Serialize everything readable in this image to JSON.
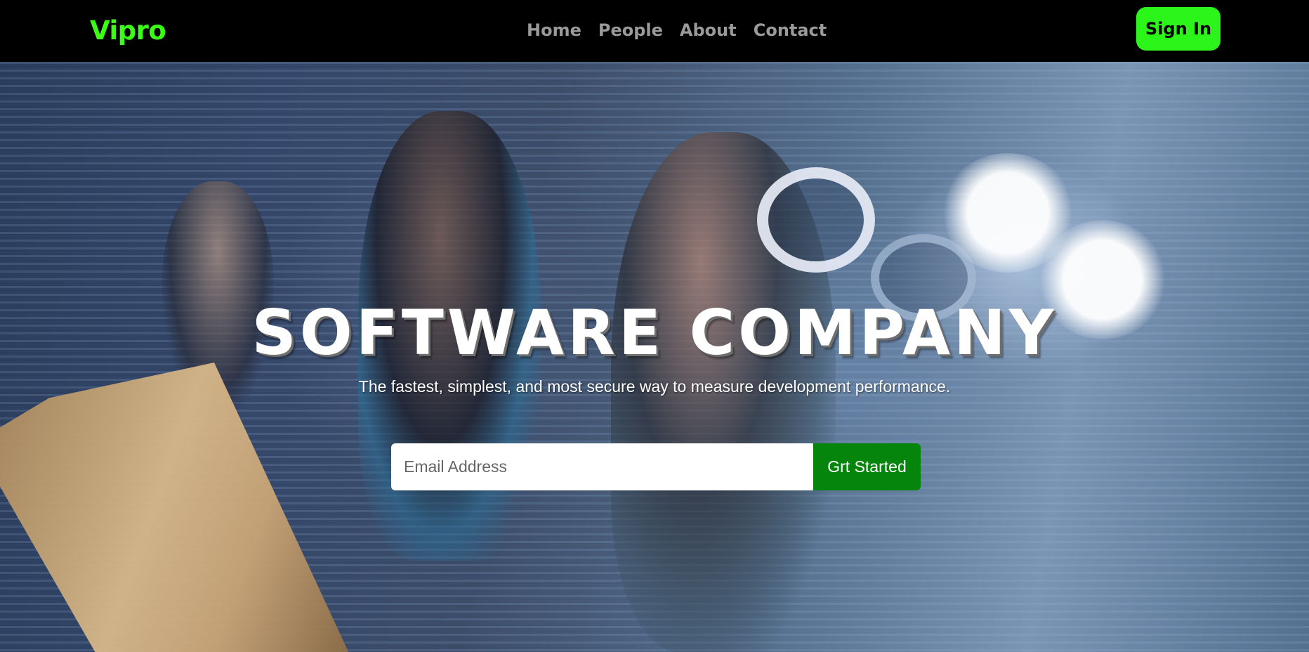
{
  "brand": {
    "name": "Vipro",
    "color": "#39ff14"
  },
  "nav": {
    "links": [
      {
        "label": "Home"
      },
      {
        "label": "People"
      },
      {
        "label": "About"
      },
      {
        "label": "Contact"
      }
    ],
    "link_color": "#9a9a9a",
    "sign_in_label": "Sign In",
    "sign_in_color": "#2cf51a"
  },
  "hero": {
    "title": "SOFTWARE COMPANY",
    "subtitle": "The fastest, simplest, and most secure way to measure development performance.",
    "email_placeholder": "Email Address",
    "email_value": "",
    "cta_label": "Grt Started",
    "cta_color": "#06850c"
  }
}
